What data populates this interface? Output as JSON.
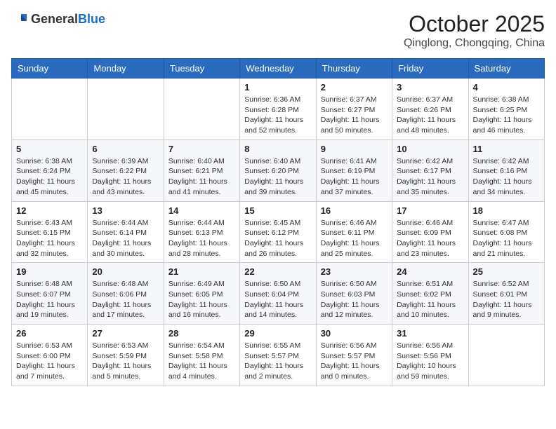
{
  "header": {
    "logo_general": "General",
    "logo_blue": "Blue",
    "title": "October 2025",
    "location": "Qinglong, Chongqing, China"
  },
  "days_of_week": [
    "Sunday",
    "Monday",
    "Tuesday",
    "Wednesday",
    "Thursday",
    "Friday",
    "Saturday"
  ],
  "weeks": [
    [
      {
        "day": "",
        "detail": ""
      },
      {
        "day": "",
        "detail": ""
      },
      {
        "day": "",
        "detail": ""
      },
      {
        "day": "1",
        "detail": "Sunrise: 6:36 AM\nSunset: 6:28 PM\nDaylight: 11 hours\nand 52 minutes."
      },
      {
        "day": "2",
        "detail": "Sunrise: 6:37 AM\nSunset: 6:27 PM\nDaylight: 11 hours\nand 50 minutes."
      },
      {
        "day": "3",
        "detail": "Sunrise: 6:37 AM\nSunset: 6:26 PM\nDaylight: 11 hours\nand 48 minutes."
      },
      {
        "day": "4",
        "detail": "Sunrise: 6:38 AM\nSunset: 6:25 PM\nDaylight: 11 hours\nand 46 minutes."
      }
    ],
    [
      {
        "day": "5",
        "detail": "Sunrise: 6:38 AM\nSunset: 6:24 PM\nDaylight: 11 hours\nand 45 minutes."
      },
      {
        "day": "6",
        "detail": "Sunrise: 6:39 AM\nSunset: 6:22 PM\nDaylight: 11 hours\nand 43 minutes."
      },
      {
        "day": "7",
        "detail": "Sunrise: 6:40 AM\nSunset: 6:21 PM\nDaylight: 11 hours\nand 41 minutes."
      },
      {
        "day": "8",
        "detail": "Sunrise: 6:40 AM\nSunset: 6:20 PM\nDaylight: 11 hours\nand 39 minutes."
      },
      {
        "day": "9",
        "detail": "Sunrise: 6:41 AM\nSunset: 6:19 PM\nDaylight: 11 hours\nand 37 minutes."
      },
      {
        "day": "10",
        "detail": "Sunrise: 6:42 AM\nSunset: 6:17 PM\nDaylight: 11 hours\nand 35 minutes."
      },
      {
        "day": "11",
        "detail": "Sunrise: 6:42 AM\nSunset: 6:16 PM\nDaylight: 11 hours\nand 34 minutes."
      }
    ],
    [
      {
        "day": "12",
        "detail": "Sunrise: 6:43 AM\nSunset: 6:15 PM\nDaylight: 11 hours\nand 32 minutes."
      },
      {
        "day": "13",
        "detail": "Sunrise: 6:44 AM\nSunset: 6:14 PM\nDaylight: 11 hours\nand 30 minutes."
      },
      {
        "day": "14",
        "detail": "Sunrise: 6:44 AM\nSunset: 6:13 PM\nDaylight: 11 hours\nand 28 minutes."
      },
      {
        "day": "15",
        "detail": "Sunrise: 6:45 AM\nSunset: 6:12 PM\nDaylight: 11 hours\nand 26 minutes."
      },
      {
        "day": "16",
        "detail": "Sunrise: 6:46 AM\nSunset: 6:11 PM\nDaylight: 11 hours\nand 25 minutes."
      },
      {
        "day": "17",
        "detail": "Sunrise: 6:46 AM\nSunset: 6:09 PM\nDaylight: 11 hours\nand 23 minutes."
      },
      {
        "day": "18",
        "detail": "Sunrise: 6:47 AM\nSunset: 6:08 PM\nDaylight: 11 hours\nand 21 minutes."
      }
    ],
    [
      {
        "day": "19",
        "detail": "Sunrise: 6:48 AM\nSunset: 6:07 PM\nDaylight: 11 hours\nand 19 minutes."
      },
      {
        "day": "20",
        "detail": "Sunrise: 6:48 AM\nSunset: 6:06 PM\nDaylight: 11 hours\nand 17 minutes."
      },
      {
        "day": "21",
        "detail": "Sunrise: 6:49 AM\nSunset: 6:05 PM\nDaylight: 11 hours\nand 16 minutes."
      },
      {
        "day": "22",
        "detail": "Sunrise: 6:50 AM\nSunset: 6:04 PM\nDaylight: 11 hours\nand 14 minutes."
      },
      {
        "day": "23",
        "detail": "Sunrise: 6:50 AM\nSunset: 6:03 PM\nDaylight: 11 hours\nand 12 minutes."
      },
      {
        "day": "24",
        "detail": "Sunrise: 6:51 AM\nSunset: 6:02 PM\nDaylight: 11 hours\nand 10 minutes."
      },
      {
        "day": "25",
        "detail": "Sunrise: 6:52 AM\nSunset: 6:01 PM\nDaylight: 11 hours\nand 9 minutes."
      }
    ],
    [
      {
        "day": "26",
        "detail": "Sunrise: 6:53 AM\nSunset: 6:00 PM\nDaylight: 11 hours\nand 7 minutes."
      },
      {
        "day": "27",
        "detail": "Sunrise: 6:53 AM\nSunset: 5:59 PM\nDaylight: 11 hours\nand 5 minutes."
      },
      {
        "day": "28",
        "detail": "Sunrise: 6:54 AM\nSunset: 5:58 PM\nDaylight: 11 hours\nand 4 minutes."
      },
      {
        "day": "29",
        "detail": "Sunrise: 6:55 AM\nSunset: 5:57 PM\nDaylight: 11 hours\nand 2 minutes."
      },
      {
        "day": "30",
        "detail": "Sunrise: 6:56 AM\nSunset: 5:57 PM\nDaylight: 11 hours\nand 0 minutes."
      },
      {
        "day": "31",
        "detail": "Sunrise: 6:56 AM\nSunset: 5:56 PM\nDaylight: 10 hours\nand 59 minutes."
      },
      {
        "day": "",
        "detail": ""
      }
    ]
  ]
}
